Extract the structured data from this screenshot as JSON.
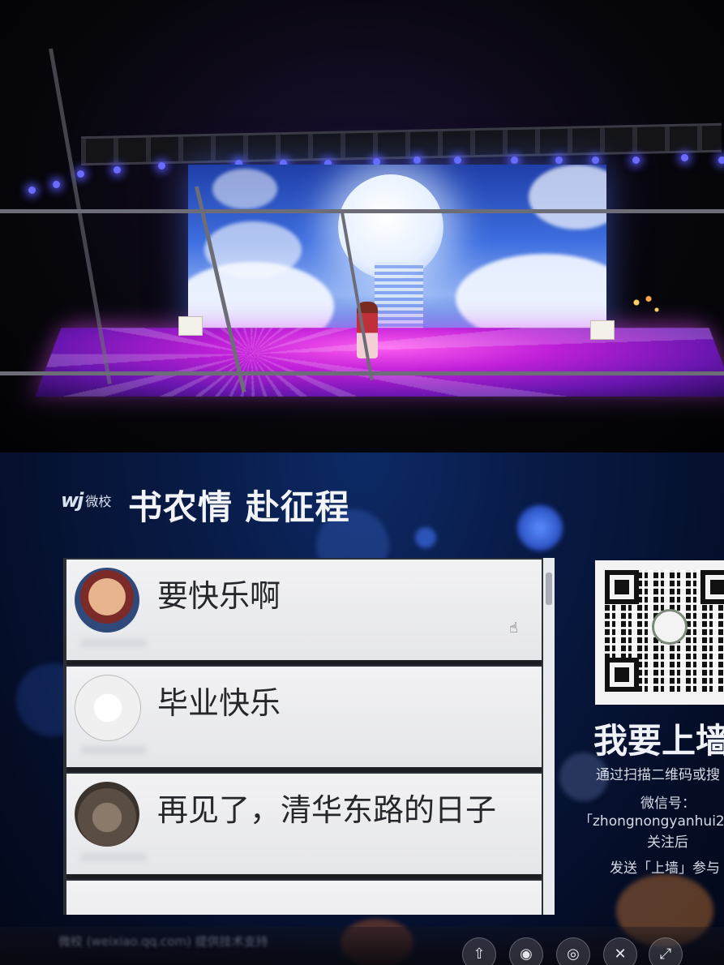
{
  "wall": {
    "brand_mark": "wj",
    "brand_name": "微校",
    "event_title": "书农情 赴征程",
    "messages": [
      {
        "text": "要快乐啊"
      },
      {
        "text": "毕业快乐"
      },
      {
        "text": "再见了，清华东路的日子"
      }
    ],
    "side": {
      "title": "我要上墙",
      "instruction": "通过扫描二维码或搜",
      "wechat_label": "微信号：",
      "wechat_id": "「zhongnongyanhui2",
      "follow": "关注后",
      "send": "发送「上墙」参与"
    },
    "footer": "微校 (weixiao.qq.com) 提供技术支持",
    "colors": {
      "background": "#081a45",
      "card": "#efeff1",
      "title": "#f2f4f8"
    }
  }
}
